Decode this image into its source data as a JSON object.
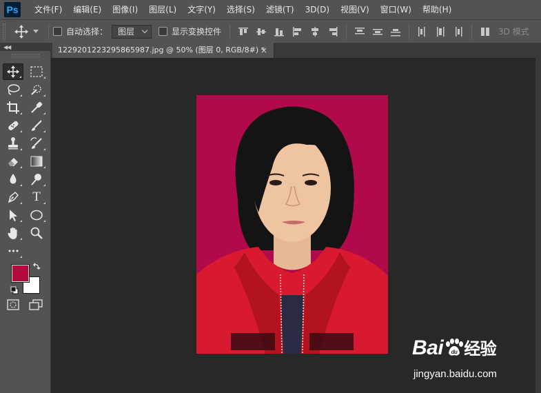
{
  "app": {
    "logo": "Ps"
  },
  "menu": [
    "文件(F)",
    "编辑(E)",
    "图像(I)",
    "图层(L)",
    "文字(Y)",
    "选择(S)",
    "滤镜(T)",
    "3D(D)",
    "视图(V)",
    "窗口(W)",
    "帮助(H)"
  ],
  "options": {
    "auto_select_label": "自动选择：",
    "auto_select_value": "图层",
    "show_transform_label": "显示变换控件",
    "mode3d_label": "3D 模式"
  },
  "document": {
    "tab_title": "1229201223295865987.jpg @ 50% (图层 0, RGB/8#) *",
    "close_glyph": "×",
    "background_color": "#b10a4a"
  },
  "colors": {
    "foreground": "#b30a3f",
    "background": "#ffffff"
  },
  "toolbar": {
    "tools": [
      "move-tool",
      "marquee-tool",
      "lasso-tool",
      "quick-select-tool",
      "crop-tool",
      "eyedropper-tool",
      "healing-brush-tool",
      "brush-tool",
      "clone-stamp-tool",
      "history-brush-tool",
      "eraser-tool",
      "gradient-tool",
      "blur-tool",
      "dodge-tool",
      "pen-tool",
      "type-tool",
      "path-select-tool",
      "ellipse-tool",
      "hand-tool",
      "zoom-tool",
      "more-tools"
    ],
    "type_tool_glyph": "T",
    "more_glyph": "•••"
  },
  "watermark": {
    "logo_left": "Bai",
    "logo_right": "经验",
    "url": "jingyan.baidu.com"
  }
}
